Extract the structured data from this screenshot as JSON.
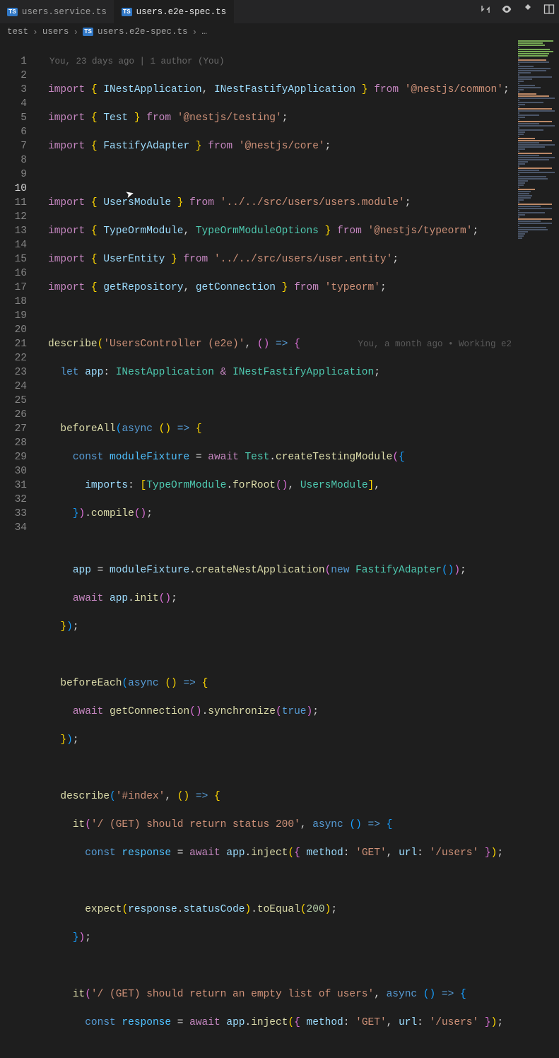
{
  "tabs": [
    {
      "badge": "TS",
      "name": "users.service.ts",
      "active": false
    },
    {
      "badge": "TS",
      "name": "users.e2e-spec.ts",
      "active": true
    }
  ],
  "breadcrumb": {
    "segments": [
      "test",
      "users"
    ],
    "filebadge": "TS",
    "file": "users.e2e-spec.ts",
    "more": "…"
  },
  "authorLine": "You, 23 days ago | 1 author (You)",
  "codelens": "You, a month ago • Working e2",
  "lineNumbers": {
    "start": 1,
    "end": 34,
    "current": 10
  },
  "code": {
    "l1": {
      "imp": "import",
      "lb": "{ ",
      "a": "INestApplication",
      "c": ", ",
      "b": "INestFastifyApplication",
      "rb": " }",
      "from": "from",
      "s": "'@nestjs/common'",
      "e": ";"
    },
    "l2": {
      "imp": "import",
      "lb": "{ ",
      "a": "Test",
      "rb": " }",
      "from": "from",
      "s": "'@nestjs/testing'",
      "e": ";"
    },
    "l3": {
      "imp": "import",
      "lb": "{ ",
      "a": "FastifyAdapter",
      "rb": " }",
      "from": "from",
      "s": "'@nestjs/core'",
      "e": ";"
    },
    "l5": {
      "imp": "import",
      "lb": "{ ",
      "a": "UsersModule",
      "rb": " }",
      "from": "from",
      "s": "'../../src/users/users.module'",
      "e": ";"
    },
    "l6": {
      "imp": "import",
      "lb": "{ ",
      "a": "TypeOrmModule",
      "c": ", ",
      "b": "TypeOrmModuleOptions",
      "rb": " }",
      "from": "from",
      "s": "'@nestjs/typeorm'",
      "e": ";"
    },
    "l7": {
      "imp": "import",
      "lb": "{ ",
      "a": "UserEntity",
      "rb": " }",
      "from": "from",
      "s": "'../../src/users/user.entity'",
      "e": ";"
    },
    "l8": {
      "imp": "import",
      "lb": "{ ",
      "a": "getRepository",
      "c": ", ",
      "b": "getConnection",
      "rb": " }",
      "from": "from",
      "s": "'typeorm'",
      "e": ";"
    },
    "l10": {
      "fn": "describe",
      "p1": "(",
      "s": "'UsersController (e2e)'",
      "c": ", ",
      "p2": "()",
      "ar": " => ",
      "lb": "{"
    },
    "l11": {
      "let": "let",
      "v": " app",
      "col": ": ",
      "t1": "INestApplication",
      "amp": " & ",
      "t2": "INestFastifyApplication",
      "e": ";"
    },
    "l13": {
      "fn": "beforeAll",
      "p1": "(",
      "as": "async",
      "p2": " ()",
      "ar": " => ",
      "lb": "{"
    },
    "l14": {
      "cn": "const",
      "v": " moduleFixture ",
      "eq": "= ",
      "aw": "await",
      "c1": " Test",
      "d": ".",
      "fn": "createTestingModule",
      "p": "(",
      "lb": "{"
    },
    "l15": {
      "k": "imports",
      "col": ": ",
      "lb": "[",
      "c1": "TypeOrmModule",
      "d": ".",
      "fn": "forRoot",
      "p": "()",
      "c": ", ",
      "c2": "UsersModule",
      "rb": "]",
      "cm": ","
    },
    "l16": {
      "rb": "}",
      "p": ")",
      "d": ".",
      "fn": "compile",
      "p2": "()",
      "e": ";"
    },
    "l18": {
      "v": "app ",
      "eq": "= ",
      "v2": "moduleFixture",
      "d": ".",
      "fn": "createNestApplication",
      "p1": "(",
      "nw": "new",
      "c1": " FastifyAdapter",
      "p2": "()",
      "p3": ")",
      "e": ";"
    },
    "l19": {
      "aw": "await",
      "v": " app",
      "d": ".",
      "fn": "init",
      "p": "()",
      "e": ";"
    },
    "l20": {
      "rb": "}",
      "p": ")",
      "e": ";"
    },
    "l22": {
      "fn": "beforeEach",
      "p1": "(",
      "as": "async",
      "p2": " ()",
      "ar": " => ",
      "lb": "{"
    },
    "l23": {
      "aw": "await",
      "sp": " ",
      "fn": "getConnection",
      "p1": "()",
      "d": ".",
      "fn2": "synchronize",
      "p2": "(",
      "tr": "true",
      "p3": ")",
      "e": ";"
    },
    "l24": {
      "rb": "}",
      "p": ")",
      "e": ";"
    },
    "l26": {
      "fn": "describe",
      "p1": "(",
      "s": "'#index'",
      "c": ", ",
      "p2": "()",
      "ar": " => ",
      "lb": "{"
    },
    "l27": {
      "fn": "it",
      "p1": "(",
      "s": "'/ (GET) should return status 200'",
      "c": ", ",
      "as": "async",
      "p2": " ()",
      "ar": " => ",
      "lb": "{"
    },
    "l28": {
      "cn": "const",
      "v": " response ",
      "eq": "= ",
      "aw": "await",
      "v2": " app",
      "d": ".",
      "fn": "inject",
      "p1": "(",
      "lb": "{ ",
      "k1": "method",
      "col": ": ",
      "s1": "'GET'",
      "c": ", ",
      "k2": "url",
      "col2": ": ",
      "s2": "'/users'",
      "rb": " }",
      "p2": ")",
      "e": ";"
    },
    "l30": {
      "fn": "expect",
      "p1": "(",
      "v": "response",
      "d": ".",
      "v2": "statusCode",
      "p2": ")",
      "d2": ".",
      "fn2": "toEqual",
      "p3": "(",
      "n": "200",
      "p4": ")",
      "e": ";"
    },
    "l31": {
      "rb": "}",
      "p": ")",
      "e": ";"
    },
    "l33": {
      "fn": "it",
      "p1": "(",
      "s": "'/ (GET) should return an empty list of users'",
      "c": ", ",
      "as": "async",
      "p2": " ()",
      "ar": " => ",
      "lb": "{"
    },
    "l34": {
      "cn": "const",
      "v": " response ",
      "eq": "= ",
      "aw": "await",
      "v2": " app",
      "d": ".",
      "fn": "inject",
      "p1": "(",
      "lb": "{ ",
      "k1": "method",
      "col": ": ",
      "s1": "'GET'",
      "c": ", ",
      "k2": "url",
      "col2": ": ",
      "s2": "'/users'",
      "rb": " }",
      "p2": ")",
      "e": ";"
    }
  }
}
